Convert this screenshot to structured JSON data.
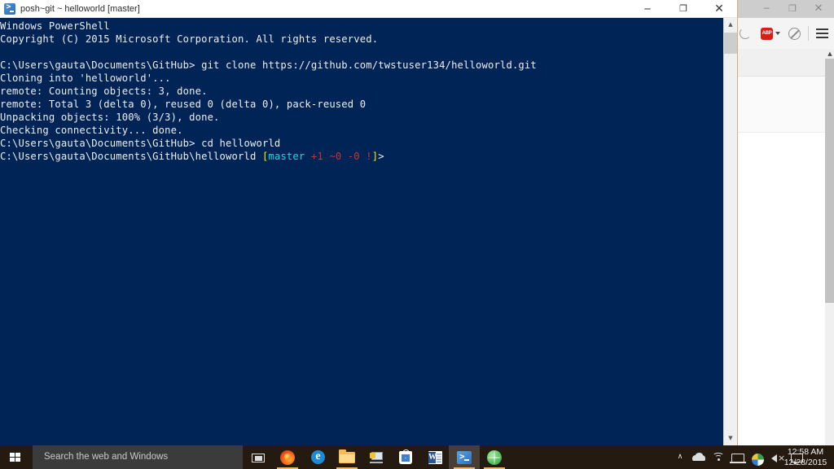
{
  "background_window": {
    "app": "firefox-browser",
    "minimize_label": "─",
    "maximize_label": "❐",
    "close_label": "✕",
    "toolbar": {
      "adblock_label": "ABP",
      "adblock_icon": "adblock-plus-icon",
      "extension_icon": "extension-icon",
      "menu_icon": "hamburger-menu-icon"
    },
    "scroll_up_label": "▲"
  },
  "powershell_window": {
    "title": "posh~git ~ helloworld [master]",
    "icon": "powershell-icon",
    "minimize_label": "─",
    "maximize_label": "❐",
    "close_label": "✕",
    "scroll_up_label": "▲",
    "scroll_down_label": "▼",
    "colors": {
      "background": "#012456",
      "foreground": "#eeeeee",
      "branch": "#1ad7d7",
      "bracket": "#f3f300",
      "dirty": "#cc3232"
    },
    "console_lines": [
      {
        "segments": [
          {
            "text": "Windows PowerShell",
            "color": "white"
          }
        ]
      },
      {
        "segments": [
          {
            "text": "Copyright (C) 2015 Microsoft Corporation. All rights reserved.",
            "color": "white"
          }
        ]
      },
      {
        "segments": [
          {
            "text": "",
            "color": "white"
          }
        ]
      },
      {
        "segments": [
          {
            "text": "C:\\Users\\gauta\\Documents\\GitHub> git clone https://github.com/twstuser134/helloworld.git",
            "color": "white"
          }
        ]
      },
      {
        "segments": [
          {
            "text": "Cloning into 'helloworld'...",
            "color": "white"
          }
        ]
      },
      {
        "segments": [
          {
            "text": "remote: Counting objects: 3, done.",
            "color": "white"
          }
        ]
      },
      {
        "segments": [
          {
            "text": "remote: Total 3 (delta 0), reused 0 (delta 0), pack-reused 0",
            "color": "white"
          }
        ]
      },
      {
        "segments": [
          {
            "text": "Unpacking objects: 100% (3/3), done.",
            "color": "white"
          }
        ]
      },
      {
        "segments": [
          {
            "text": "Checking connectivity... done.",
            "color": "white"
          }
        ]
      },
      {
        "segments": [
          {
            "text": "C:\\Users\\gauta\\Documents\\GitHub> cd helloworld",
            "color": "white"
          }
        ]
      },
      {
        "segments": [
          {
            "text": "C:\\Users\\gauta\\Documents\\GitHub\\helloworld ",
            "color": "white"
          },
          {
            "text": "[",
            "color": "yellow"
          },
          {
            "text": "master",
            "color": "cyan"
          },
          {
            "text": " +1 ~0 -0 !",
            "color": "red"
          },
          {
            "text": "]",
            "color": "yellow"
          },
          {
            "text": ">",
            "color": "white"
          }
        ]
      }
    ]
  },
  "taskbar": {
    "start_label": "start-button",
    "search": {
      "placeholder": "Search the web and Windows",
      "value": ""
    },
    "items": [
      {
        "name": "task-view",
        "icon": "task-view-icon",
        "running": false,
        "active": false
      },
      {
        "name": "firefox",
        "icon": "firefox-icon",
        "running": true,
        "active": false
      },
      {
        "name": "microsoft-edge",
        "icon": "edge-icon",
        "running": false,
        "active": false
      },
      {
        "name": "file-explorer",
        "icon": "folder-icon",
        "running": true,
        "active": false
      },
      {
        "name": "remote-desktop",
        "icon": "remote-desktop-icon",
        "running": false,
        "active": false
      },
      {
        "name": "windows-store",
        "icon": "store-icon",
        "running": false,
        "active": false
      },
      {
        "name": "microsoft-word",
        "icon": "word-icon",
        "running": false,
        "active": false
      },
      {
        "name": "powershell",
        "icon": "powershell-icon",
        "running": true,
        "active": true
      },
      {
        "name": "globe-app",
        "icon": "globe-icon",
        "running": true,
        "active": false
      }
    ],
    "tray": {
      "expand_label": "∧",
      "icons": [
        "onedrive-icon",
        "wifi-icon",
        "network-icon",
        "security-essentials-icon",
        "volume-muted-icon",
        "action-center-icon"
      ],
      "volume_mute_label": "×"
    },
    "clock": {
      "time": "12:58 AM",
      "date": "12/28/2015"
    }
  }
}
